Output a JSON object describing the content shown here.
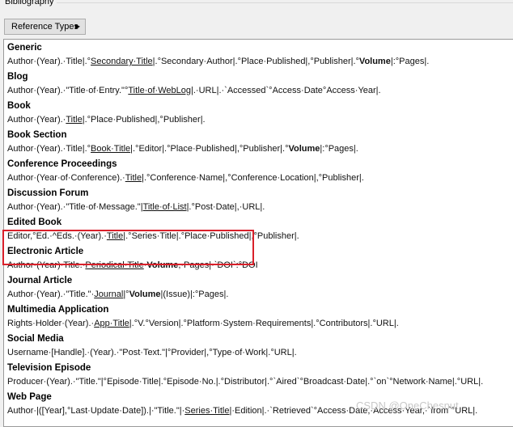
{
  "group": {
    "label": "Bibliography"
  },
  "toolbar": {
    "ref_types_label": "Reference Types"
  },
  "entries": [
    {
      "name": "Generic",
      "parts": [
        {
          "t": "Author·(Year).·Title|.°"
        },
        {
          "t": "Secondary·Title",
          "u": true
        },
        {
          "t": "|.°Secondary·Author|.°Place·Published|,°Publisher|.°"
        },
        {
          "t": "Volume",
          "b": true
        },
        {
          "t": "|:°Pages|."
        }
      ]
    },
    {
      "name": "Blog",
      "parts": [
        {
          "t": "Author·(Year).·\"Title·of·Entry.\"°"
        },
        {
          "t": "Title·of·WebLog",
          "u": true
        },
        {
          "t": "|.·URL|.·`Accessed`°Access·Date°Access·Year|."
        }
      ]
    },
    {
      "name": "Book",
      "parts": [
        {
          "t": "Author·(Year).·"
        },
        {
          "t": "Title",
          "u": true
        },
        {
          "t": "|.°Place·Published|,°Publisher|."
        }
      ]
    },
    {
      "name": "Book Section",
      "parts": [
        {
          "t": "Author·(Year).·Title|.°"
        },
        {
          "t": "Book·Title",
          "u": true
        },
        {
          "t": "|.°Editor|.°Place·Published|,°Publisher|.°"
        },
        {
          "t": "Volume",
          "b": true
        },
        {
          "t": "|:°Pages|."
        }
      ]
    },
    {
      "name": "Conference Proceedings",
      "parts": [
        {
          "t": "Author·(Year·of·Conference).·"
        },
        {
          "t": "Title",
          "u": true
        },
        {
          "t": "|.°Conference·Name|,°Conference·Location|,°Publisher|."
        }
      ]
    },
    {
      "name": "Discussion Forum",
      "parts": [
        {
          "t": "Author·(Year).·\"Title·of·Message.\"|"
        },
        {
          "t": "Title·of·List",
          "u": true
        },
        {
          "t": "|.°Post·Date|,·URL|."
        }
      ]
    },
    {
      "name": "Edited Book",
      "parts": [
        {
          "t": "Editor,°Ed.·^Eds.·(Year).·"
        },
        {
          "t": "Title",
          "u": true
        },
        {
          "t": "|.°Series·Title|.°Place·Published|,°Publisher|."
        }
      ]
    },
    {
      "name": "Electronic Article",
      "parts": [
        {
          "t": "Author·(Year)·Title.·"
        },
        {
          "t": "Periodical·Title",
          "u": true
        },
        {
          "t": "·"
        },
        {
          "t": "Volume",
          "b": true
        },
        {
          "t": ",·Pages|·`DOI`:°DOI"
        }
      ]
    },
    {
      "name": "Journal Article",
      "parts": [
        {
          "t": "Author·(Year).·\"Title.\"·"
        },
        {
          "t": "Journal",
          "u": true
        },
        {
          "t": "|°"
        },
        {
          "t": "Volume",
          "b": true
        },
        {
          "t": "|(Issue)|:°Pages|."
        }
      ]
    },
    {
      "name": "Multimedia Application",
      "parts": [
        {
          "t": "Rights·Holder·(Year).·"
        },
        {
          "t": "App·Title",
          "u": true
        },
        {
          "t": "|.°V.°Version|.°Platform·System·Requirements|.°Contributors|.°URL|."
        }
      ]
    },
    {
      "name": "Social Media",
      "parts": [
        {
          "t": "Username·[Handle].·(Year).·\"Post·Text.\"|°Provider|,°Type·of·Work|.°URL|."
        }
      ]
    },
    {
      "name": "Television Episode",
      "parts": [
        {
          "t": "Producer·(Year).·\"Title.\"|°Episode·Title|.°Episode·No.|.°Distributor|.°`Aired`°Broadcast·Date|.°`on`°Network·Name|.°URL|."
        }
      ]
    },
    {
      "name": "Web Page",
      "parts": [
        {
          "t": "Author·|([Year],°Last·Update·Date]).|·\"Title.\"|·"
        },
        {
          "t": "Series·Title",
          "u": true
        },
        {
          "t": "|·Edition|.·`Retrieved`°Access·Date,·Access·Year,·`from`°URL|."
        }
      ]
    }
  ],
  "watermark": "CSDN @OneChesnut",
  "colors": {
    "highlight": "#d9202a"
  }
}
